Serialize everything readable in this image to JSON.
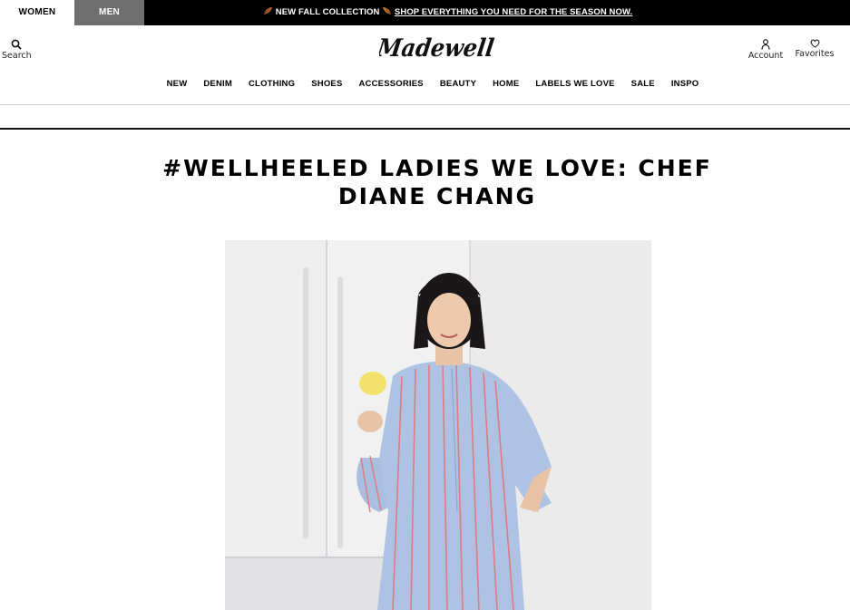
{
  "topbar": {
    "tab_women": "WOMEN",
    "tab_men": "MEN",
    "promo_text": "NEW FALL COLLECTION",
    "promo_link": "SHOP EVERYTHING YOU NEED FOR THE SEASON NOW."
  },
  "header": {
    "search_label": "Search",
    "logo_text": "Madewell",
    "account_label": "Account",
    "favorites_label": "Favorites"
  },
  "nav": {
    "items": [
      "NEW",
      "DENIM",
      "CLOTHING",
      "SHOES",
      "ACCESSORIES",
      "BEAUTY",
      "HOME",
      "LABELS WE LOVE",
      "SALE",
      "INSPO"
    ]
  },
  "article": {
    "title": "#WELLHEELED LADIES WE LOVE: CHEF DIANE CHANG"
  },
  "colors": {
    "topbar_bg": "#000000",
    "men_tab_bg": "#6f6f6f",
    "text": "#000000"
  }
}
